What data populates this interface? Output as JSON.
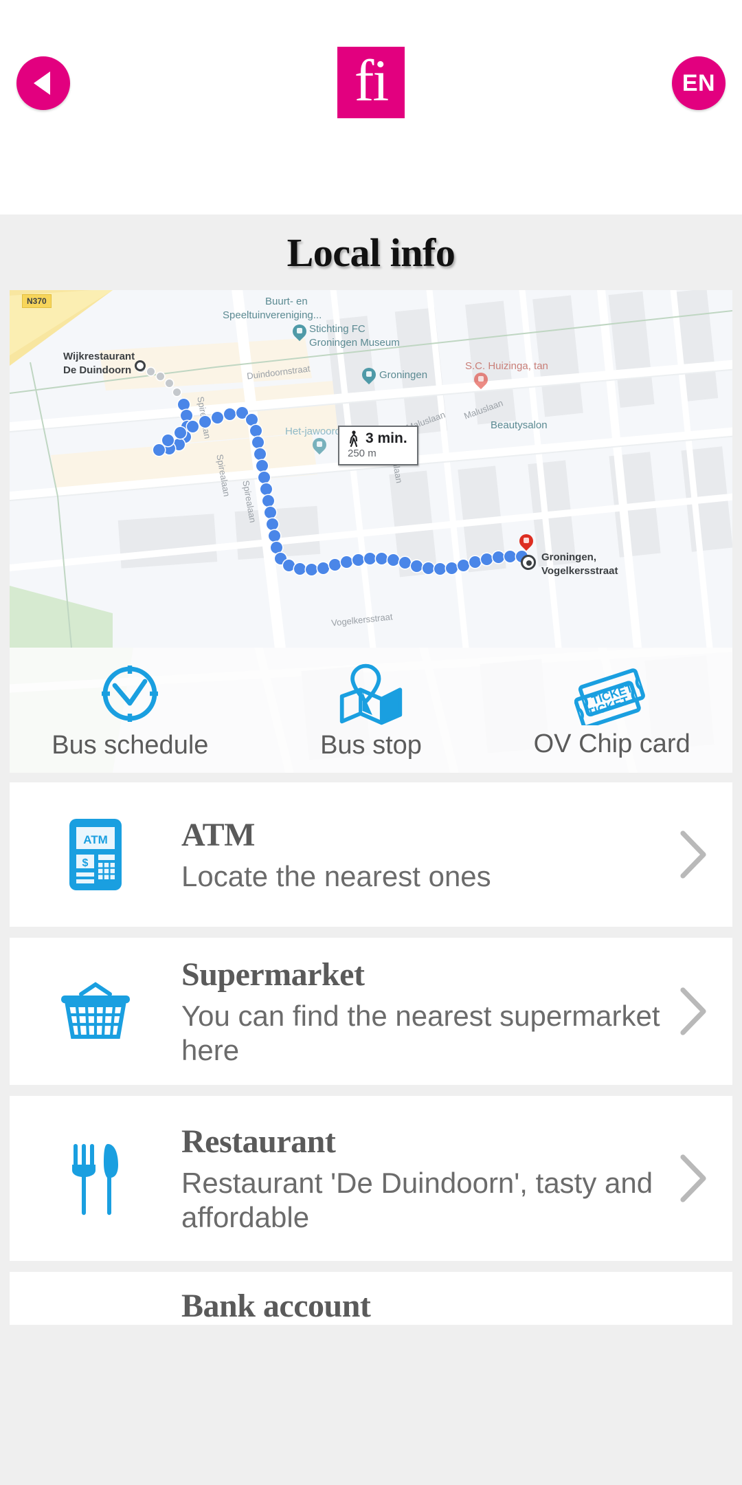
{
  "header": {
    "back_icon": "back-triangle-icon",
    "logo_text": "fi",
    "language_label": "EN"
  },
  "page": {
    "title": "Local info"
  },
  "map": {
    "walk_badge": {
      "duration": "3 min.",
      "distance": "250 m",
      "icon": "walking-person-icon"
    },
    "road_shield": "N370",
    "origin_label_line1": "Wijkrestaurant",
    "origin_label_line2": "De Duindoorn",
    "destination_label_line1": "Groningen,",
    "destination_label_line2": "Vogelkersstraat",
    "pois": [
      {
        "name": "Buurt- en",
        "name2": "Speeltuinvereniging..."
      },
      {
        "name": "Stichting FC",
        "name2": "Groningen Museum"
      },
      {
        "name": "Groningen"
      },
      {
        "name": "S.C. Huizinga, tan"
      },
      {
        "name": "Het-jawoord"
      },
      {
        "name": "Beautysalon"
      }
    ],
    "streets": [
      "Duindoornstraat",
      "Spirealaan",
      "Spirealaan",
      "Spirealaan",
      "Maluslaan",
      "Maluslaan",
      "Elzenlaan",
      "Vogelkersstraat"
    ]
  },
  "transit": {
    "items": [
      {
        "label": "Bus schedule",
        "icon": "clock-icon"
      },
      {
        "label": "Bus stop",
        "icon": "map-pin-fold-icon"
      },
      {
        "label": "OV Chip card",
        "icon": "ticket-icon"
      }
    ]
  },
  "info_cards": [
    {
      "title": "ATM",
      "subtitle": "Locate the nearest ones",
      "icon": "atm-machine-icon",
      "chevron": "chevron-right-icon"
    },
    {
      "title": "Supermarket",
      "subtitle": "You can find the nearest supermarket here",
      "icon": "shopping-basket-icon",
      "chevron": "chevron-right-icon"
    },
    {
      "title": "Restaurant",
      "subtitle": "Restaurant 'De Duindoorn', tasty and affordable",
      "icon": "fork-knife-icon",
      "chevron": "chevron-right-icon"
    },
    {
      "title": "Bank account",
      "subtitle": "",
      "icon": "bank-icon",
      "chevron": "chevron-right-icon"
    }
  ],
  "colors": {
    "brand_pink": "#e2007f",
    "icon_blue": "#1a9fe0",
    "page_bg": "#efefef",
    "card_bg": "#ffffff",
    "text_gray": "#5a5a5a"
  }
}
